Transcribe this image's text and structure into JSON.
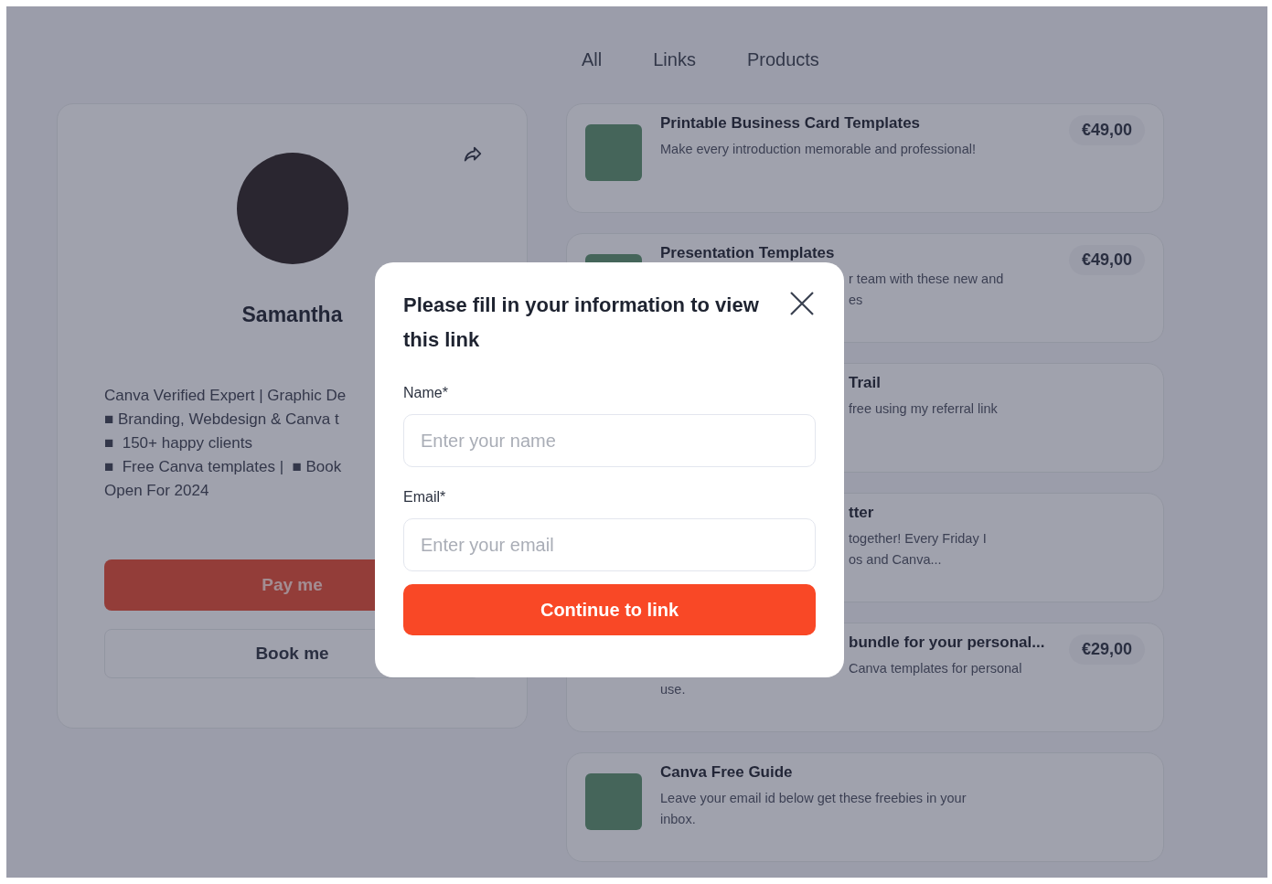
{
  "tabs": [
    {
      "label": "All"
    },
    {
      "label": "Links"
    },
    {
      "label": "Products"
    }
  ],
  "profile": {
    "name": "Samantha",
    "bio": [
      {
        "text": "Canva Verified Expert | Graphic De"
      },
      {
        "text": "■ Branding, Webdesign & Canva t"
      },
      {
        "text": "■  150+ happy clients"
      },
      {
        "text": "■  Free Canva templates |  ■ Book"
      },
      {
        "text": "Open For 2024"
      }
    ],
    "buttons": [
      {
        "label": "Pay me",
        "kind": "primary"
      },
      {
        "label": "Book me",
        "kind": "outline"
      }
    ]
  },
  "items": [
    {
      "thumbnail": true,
      "title": {
        "text": "Printable Business Card Templates"
      },
      "lines": [
        {
          "text": "Make every introduction memorable and professional!"
        }
      ],
      "price": "€49,00"
    },
    {
      "thumbnail": true,
      "title": {
        "text": "Presentation Templates"
      },
      "lines": [
        {
          "text": "r team with these new and",
          "covered": true
        },
        {
          "text": "es",
          "covered": true
        }
      ],
      "price": "€49,00"
    },
    {
      "thumbnail": false,
      "title": {
        "text": "Trail",
        "covered": true
      },
      "lines": [
        {
          "text": "free using my referral link",
          "covered": true
        }
      ]
    },
    {
      "thumbnail": false,
      "title": {
        "text": "tter",
        "covered": true
      },
      "lines": [
        {
          "text": "together! Every Friday I",
          "covered": true
        },
        {
          "text": "os and Canva...",
          "covered": true
        }
      ]
    },
    {
      "thumbnail": false,
      "title": {
        "text": "bundle for your personal...",
        "covered": true
      },
      "lines": [
        {
          "text": "Canva templates for personal",
          "covered": true
        },
        {
          "text": "use."
        }
      ],
      "price": "€29,00"
    },
    {
      "thumbnail": true,
      "title": {
        "text": "Canva Free Guide"
      },
      "lines": [
        {
          "text": "Leave your email id below get these freebies in your"
        },
        {
          "text": "inbox."
        }
      ]
    }
  ],
  "modal": {
    "title": "Please fill in your information to view this link",
    "fields": [
      {
        "label": "Name*",
        "placeholder": "Enter your name"
      },
      {
        "label": "Email*",
        "placeholder": "Enter your email"
      }
    ],
    "button": "Continue to link"
  }
}
